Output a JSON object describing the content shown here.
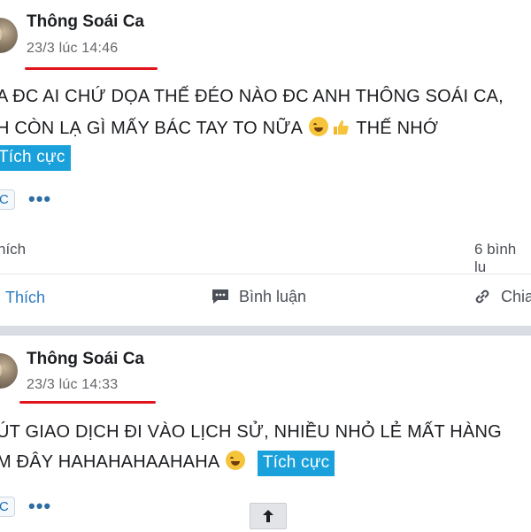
{
  "posts": [
    {
      "author": "Thông Soái Ca",
      "timestamp": "23/3 lúc 14:46",
      "lines": [
        "A ĐC AI CHỨ DỌA THẾ ĐÉO NÀO ĐC ANH THÔNG SOÁI CA,",
        "H CÒN LẠ GÌ MẤY BÁC TAY TO NỮA"
      ],
      "line2_suffix": "THẾ NHỚ",
      "tag": "Tích cực",
      "reaction_chip": "C",
      "more": "•••",
      "likes_text": "hích",
      "comments_count": "6 bình lu",
      "actions": {
        "like": "Thích",
        "comment": "Bình luận",
        "share": "Chia"
      }
    },
    {
      "author": "Thông Soái Ca",
      "timestamp": "23/3 lúc 14:33",
      "lines": [
        "ÚT GIAO DỊCH ĐI VÀO LỊCH SỬ, NHIỀU NHỎ LẺ MẤT HÀNG",
        "M ĐÂY HAHAHAHAAHAHA"
      ],
      "tag": "Tích cực",
      "reaction_chip": "C",
      "more": "•••"
    }
  ],
  "scroll_top": {
    "icon": "arrow-up-icon"
  },
  "colors": {
    "tag_bg": "#1aa1dc",
    "underline": "#e0141b",
    "link_blue": "#2d7bbf"
  }
}
